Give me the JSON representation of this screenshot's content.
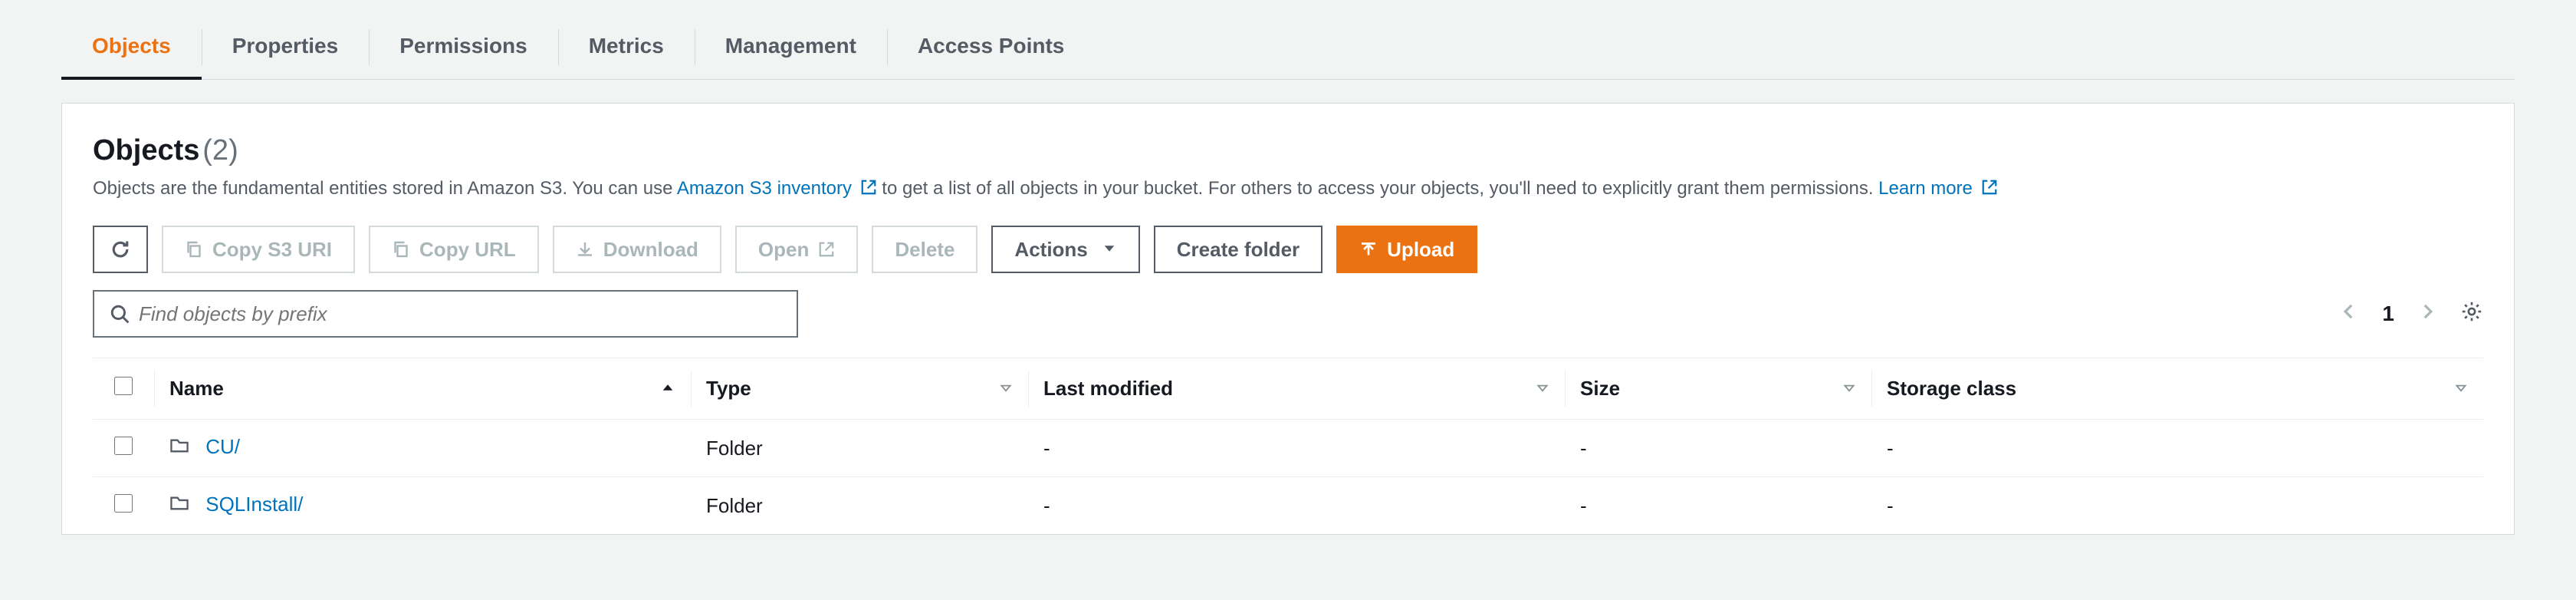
{
  "tabs": {
    "objects": "Objects",
    "properties": "Properties",
    "permissions": "Permissions",
    "metrics": "Metrics",
    "management": "Management",
    "access_points": "Access Points"
  },
  "header": {
    "title": "Objects",
    "count": "(2)"
  },
  "description": {
    "part1": "Objects are the fundamental entities stored in Amazon S3. You can use ",
    "inventory_link": "Amazon S3 inventory",
    "part2": " to get a list of all objects in your bucket. For others to access your objects, you'll need to explicitly grant them permissions. ",
    "learn_more": "Learn more"
  },
  "toolbar": {
    "copy_s3_uri": "Copy S3 URI",
    "copy_url": "Copy URL",
    "download": "Download",
    "open": "Open",
    "delete": "Delete",
    "actions": "Actions",
    "create_folder": "Create folder",
    "upload": "Upload"
  },
  "search": {
    "placeholder": "Find objects by prefix"
  },
  "pager": {
    "page": "1"
  },
  "columns": {
    "name": "Name",
    "type": "Type",
    "last_modified": "Last modified",
    "size": "Size",
    "storage_class": "Storage class"
  },
  "rows": [
    {
      "name": "CU/",
      "type": "Folder",
      "last_modified": "-",
      "size": "-",
      "storage_class": "-"
    },
    {
      "name": "SQLInstall/",
      "type": "Folder",
      "last_modified": "-",
      "size": "-",
      "storage_class": "-"
    }
  ]
}
